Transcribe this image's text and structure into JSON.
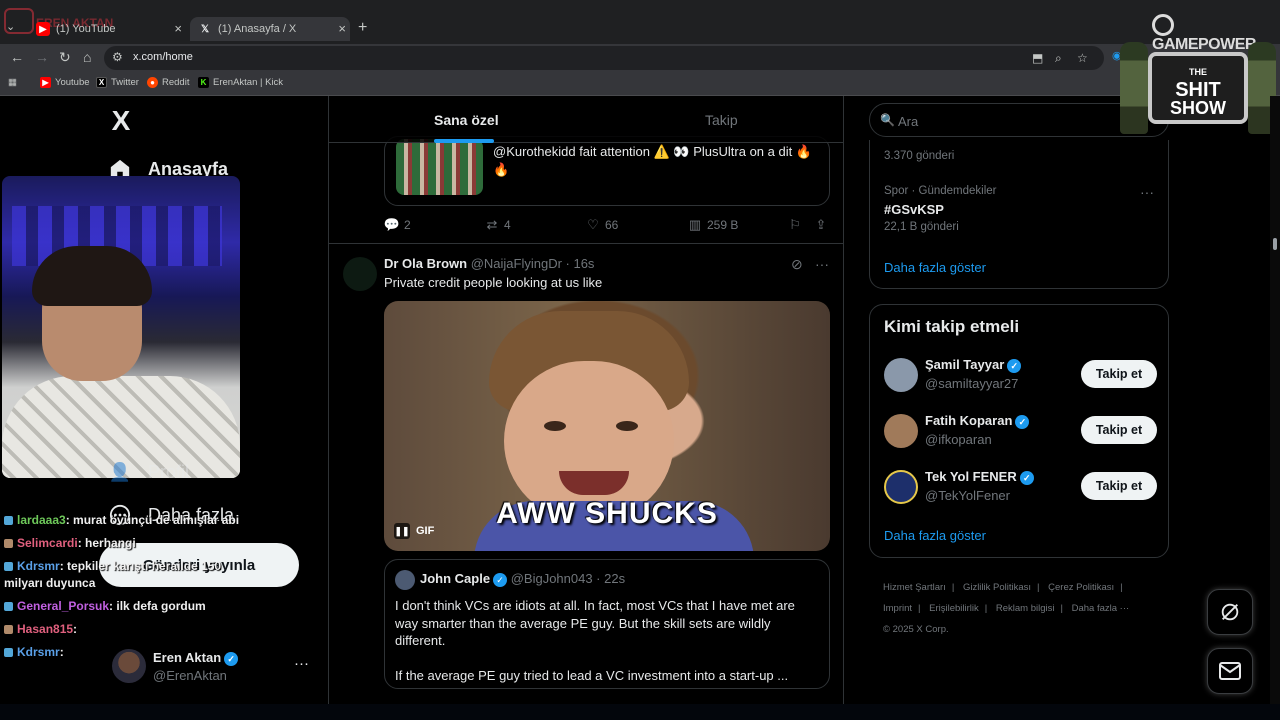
{
  "browser": {
    "tabs": [
      {
        "title": "(1) YouTube",
        "active": false
      },
      {
        "title": "(1) Anasayfa / X",
        "active": true
      }
    ],
    "new_tab": "+",
    "url": "x.com/home",
    "bookmarks": [
      {
        "label": "Youtube",
        "color": "#ff0000",
        "icon": "youtube-icon"
      },
      {
        "label": "Twitter",
        "color": "#000000",
        "icon": "x-icon"
      },
      {
        "label": "Reddit",
        "color": "#ff4500",
        "icon": "reddit-icon"
      },
      {
        "label": "ErenAktan | Kick",
        "color": "#53fc18",
        "icon": "kick-icon"
      }
    ]
  },
  "overlay": {
    "streamer_name": "EREN AKTAN",
    "brand": "GAMEPOWER",
    "show_logo_lines": [
      "THE",
      "SHIT",
      "SHOW"
    ],
    "chat": [
      {
        "user": "lardaaa3",
        "color": "#6ec85a",
        "text": ": murat övünçü de almışlar abi"
      },
      {
        "user": "Selimcardi",
        "color": "#e0607e",
        "text": ": herhangi"
      },
      {
        "user": "Kdrsmr",
        "color": "#5aa0e8",
        "text": ": tepkiler karıştı herailde 150 milyarı duyunca"
      },
      {
        "user": "General_Porsuk",
        "color": "#c060e0",
        "text": ": ilk defa gordum"
      },
      {
        "user": "Hasan815",
        "color": "#e0607e",
        "text": ":"
      },
      {
        "user": "Kdrsmr",
        "color": "#5aa0e8",
        "text": ":"
      }
    ]
  },
  "sidebar": {
    "logo": "X",
    "items": [
      {
        "label": "Anasayfa",
        "icon": "home-icon"
      },
      {
        "label": "Profil",
        "icon": "profile-icon"
      },
      {
        "label": "Daha fazla",
        "icon": "more-circle-icon"
      }
    ],
    "post_button": "Gönderi yayınla",
    "account": {
      "name": "Eren Aktan",
      "handle": "@ErenAktan",
      "more": "···"
    }
  },
  "timeline": {
    "tabs": [
      {
        "label": "Sana özel",
        "active": true
      },
      {
        "label": "Takip",
        "active": false
      }
    ],
    "prev_post": {
      "card_text": "@Kurothekidd fait attention ⚠️ 👀 PlusUltra on a dit 🔥🔥",
      "replies": "2",
      "reposts": "4",
      "likes": "66",
      "views": "259 B"
    },
    "post": {
      "name": "Dr Ola Brown",
      "handle": "@NaijaFlyingDr · 16s",
      "text": "Private credit people looking at us like",
      "gif_caption": "AWW SHUCKS",
      "gif_label": "GIF",
      "quote": {
        "name": "John Caple",
        "handle": "@BigJohn043 · 22s",
        "text_1": "I don't think VCs are idiots at all.  In fact, most VCs that I have met are way smarter than the average PE guy.  But the skill sets are wildly different.",
        "text_2": "If the average PE guy tried to lead a VC investment into a start-up ..."
      }
    }
  },
  "right": {
    "search_placeholder": "Ara",
    "trends": {
      "first_count": "3.370 gönderi",
      "second_category": "Spor · Gündemdekiler",
      "second_title": "#GSvKSP",
      "second_count": "22,1 B gönderi",
      "more_link": "Daha fazla göster"
    },
    "who_to_follow": {
      "title": "Kimi takip etmeli",
      "users": [
        {
          "name": "Şamil Tayyar",
          "handle": "@samiltayyar27",
          "button": "Takip et",
          "color": "#8a98aa"
        },
        {
          "name": "Fatih Koparan",
          "handle": "@ifkoparan",
          "button": "Takip et",
          "color": "#a07a5a"
        },
        {
          "name": "Tek Yol FENER",
          "handle": "@TekYolFener",
          "button": "Takip et",
          "color": "#1d2f6b"
        }
      ],
      "more_link": "Daha fazla göster"
    },
    "footer": [
      "Hizmet Şartları",
      "|",
      "Gizlilik Politikası",
      "|",
      "Çerez Politikası",
      "|",
      "Imprint",
      "|",
      "Erişilebilirlik",
      "|",
      "Reklam bilgisi",
      "|",
      "Daha fazla ···",
      "© 2025 X Corp."
    ]
  },
  "colors": {
    "accent": "#1d9bf0",
    "background": "#000000",
    "border": "#2f3336",
    "muted": "#71767b"
  }
}
